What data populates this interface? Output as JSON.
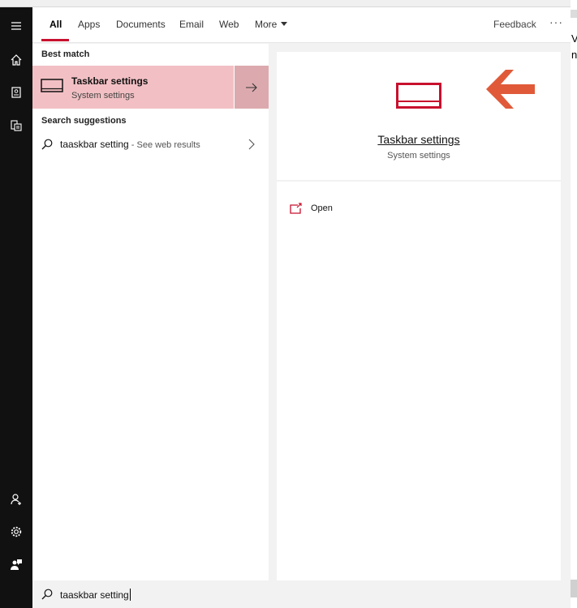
{
  "background": {
    "right_text_1": "V",
    "right_text_2": "nc"
  },
  "rail": {
    "top_icons": [
      "hamburger-icon",
      "home-icon",
      "notebook-icon",
      "documents-icon"
    ],
    "bottom_icons": [
      "user-add-icon",
      "gear-icon",
      "feedback-person-icon"
    ]
  },
  "tabs": [
    {
      "label": "All",
      "active": true
    },
    {
      "label": "Apps",
      "active": false
    },
    {
      "label": "Documents",
      "active": false
    },
    {
      "label": "Email",
      "active": false
    },
    {
      "label": "Web",
      "active": false
    },
    {
      "label": "More",
      "active": false
    }
  ],
  "header": {
    "feedback_label": "Feedback",
    "more_options": "···"
  },
  "results": {
    "best_match_label": "Best match",
    "best_match": {
      "title": "Taskbar settings",
      "subtitle": "System settings",
      "icon": "taskbar-icon"
    },
    "suggestions_label": "Search suggestions",
    "suggestions": [
      {
        "query": "taaskbar setting",
        "hint": " - See web results"
      }
    ]
  },
  "preview": {
    "title": "Taskbar settings",
    "subtitle": "System settings",
    "actions": [
      {
        "label": "Open",
        "icon": "open-external-icon"
      }
    ]
  },
  "search": {
    "value": "taaskbar setting"
  },
  "colors": {
    "accent": "#c8102e",
    "selected_bg": "#f2c0c4",
    "selected_arrow_bg": "#dcaaae",
    "annotation_arrow": "#e05a3a"
  }
}
